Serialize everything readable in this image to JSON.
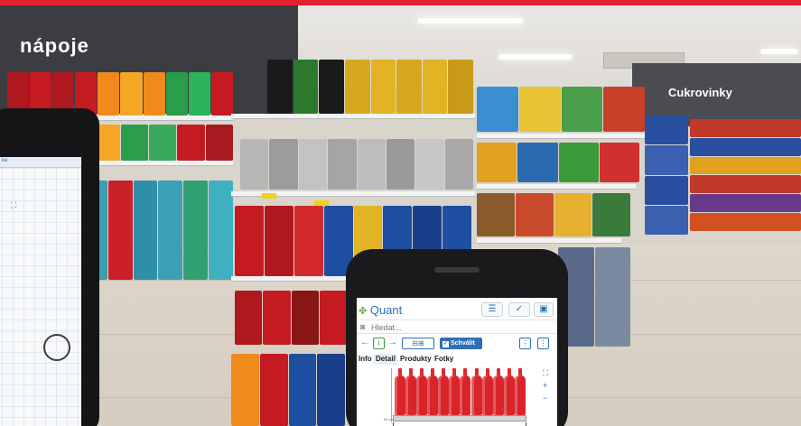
{
  "store": {
    "sign_left": "nápoje",
    "sign_right": "Cukrovinky"
  },
  "colors": {
    "accent_red": "#e3202f",
    "app_blue": "#2f6fb5",
    "app_green": "#6fb33b"
  },
  "phone_app": {
    "logo_text": "Quant",
    "logo_icon": "quant-leaf-icon",
    "header_buttons": [
      {
        "icon": "menu-icon",
        "glyph": "☰"
      },
      {
        "icon": "check-circle-icon",
        "glyph": "✓"
      },
      {
        "icon": "save-icon",
        "glyph": "▣"
      }
    ],
    "search": {
      "icon": "camera-icon",
      "placeholder": "Hledat..."
    },
    "toolbar": {
      "back_glyph": "←",
      "forward_glyph": "→",
      "box_glyph": "I",
      "layout_glyph": "⊟⊞",
      "approve_label": "Schválit",
      "approve_icon": "checkbox-icon",
      "menu_glyph": "⋮"
    },
    "tabs": [
      {
        "label": "Info",
        "active": false
      },
      {
        "label": "Detail",
        "active": true
      },
      {
        "label": "Produkty",
        "active": false
      },
      {
        "label": "Fotky",
        "active": false
      }
    ],
    "planogram": {
      "bottle_count": 12,
      "shelf_label": "– – –",
      "dimension_label": "64 cm"
    },
    "side_controls": {
      "fit_glyph": "⛶",
      "zoom_in_glyph": "+",
      "zoom_out_glyph": "−"
    }
  },
  "tablet": {
    "tab_label": "ke",
    "icon_glyph": "⛶"
  }
}
